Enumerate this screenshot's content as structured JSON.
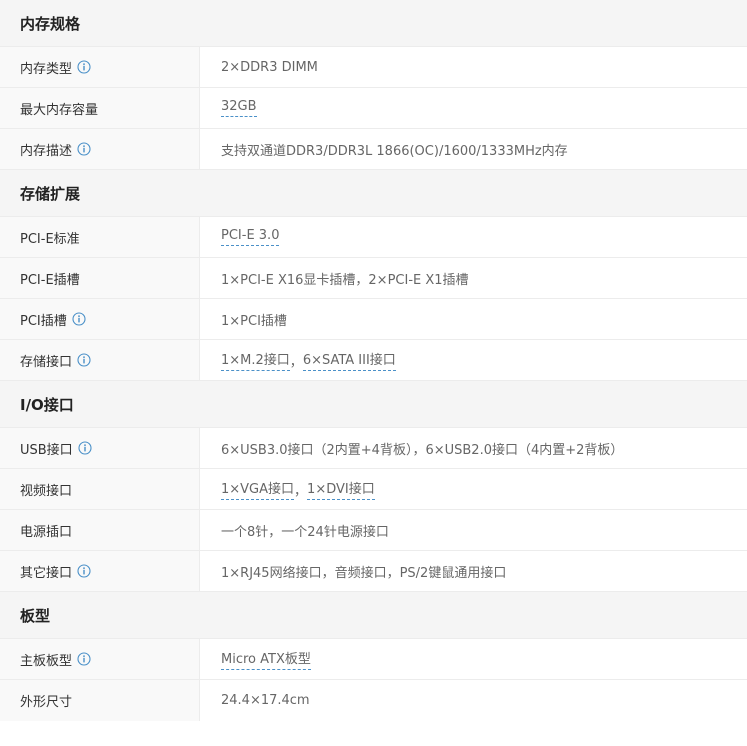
{
  "colors": {
    "header_bg": "#f5f5f5",
    "label_bg": "#f9f9f9",
    "border": "#ececec",
    "info_icon": "#4a90c8",
    "link_underline": "#4a90c8"
  },
  "sections": [
    {
      "title": "内存规格",
      "rows": [
        {
          "label": "内存类型",
          "info": true,
          "value": "2×DDR3 DIMM"
        },
        {
          "label": "最大内存容量",
          "info": false,
          "links": [
            "32GB"
          ]
        },
        {
          "label": "内存描述",
          "info": true,
          "value": "支持双通道DDR3/DDR3L 1866(OC)/1600/1333MHz内存"
        }
      ]
    },
    {
      "title": "存储扩展",
      "rows": [
        {
          "label": "PCI-E标准",
          "info": false,
          "links": [
            "PCI-E 3.0"
          ]
        },
        {
          "label": "PCI-E插槽",
          "info": false,
          "value": "1×PCI-E X16显卡插槽，2×PCI-E X1插槽"
        },
        {
          "label": "PCI插槽",
          "info": true,
          "value": "1×PCI插槽"
        },
        {
          "label": "存储接口",
          "info": true,
          "links": [
            "1×M.2接口",
            "6×SATA III接口"
          ],
          "separator": "，"
        }
      ]
    },
    {
      "title": "I/O接口",
      "rows": [
        {
          "label": "USB接口",
          "info": true,
          "value": "6×USB3.0接口（2内置+4背板），6×USB2.0接口（4内置+2背板）"
        },
        {
          "label": "视频接口",
          "info": false,
          "links": [
            "1×VGA接口",
            "1×DVI接口"
          ],
          "separator": "，"
        },
        {
          "label": "电源插口",
          "info": false,
          "value": "一个8针，一个24针电源接口"
        },
        {
          "label": "其它接口",
          "info": true,
          "value": "1×RJ45网络接口，音频接口，PS/2键鼠通用接口"
        }
      ]
    },
    {
      "title": "板型",
      "rows": [
        {
          "label": "主板板型",
          "info": true,
          "links": [
            "Micro ATX板型"
          ]
        },
        {
          "label": "外形尺寸",
          "info": false,
          "value": "24.4×17.4cm"
        }
      ]
    }
  ]
}
